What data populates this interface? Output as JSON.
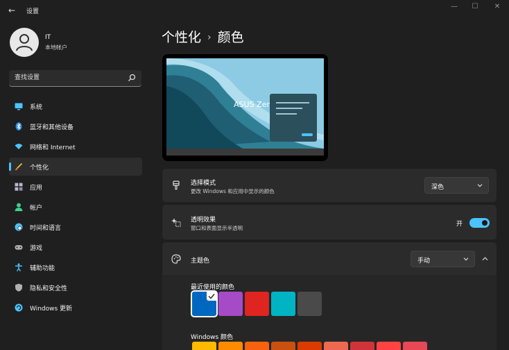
{
  "window": {
    "title": "设置",
    "controls": {
      "minimize": "—",
      "maximize": "☐",
      "close": "✕"
    }
  },
  "user": {
    "name": "IT",
    "account_type": "本地帐户"
  },
  "search": {
    "placeholder": "查找设置",
    "value": ""
  },
  "sidebar": {
    "items": [
      {
        "label": "系统",
        "icon": "monitor-icon",
        "color": "#4cc2ff"
      },
      {
        "label": "蓝牙和其他设备",
        "icon": "bluetooth-icon",
        "color": "#4cc2ff"
      },
      {
        "label": "网络和 Internet",
        "icon": "wifi-icon",
        "color": "#4cc2ff"
      },
      {
        "label": "个性化",
        "icon": "brush-icon",
        "color": "#f0a030",
        "active": true
      },
      {
        "label": "应用",
        "icon": "apps-icon",
        "color": "#b0b0c8"
      },
      {
        "label": "帐户",
        "icon": "person-icon",
        "color": "#3ecf8e"
      },
      {
        "label": "时间和语言",
        "icon": "globe-clock-icon",
        "color": "#4cc2ff"
      },
      {
        "label": "游戏",
        "icon": "gamepad-icon",
        "color": "#b0b0b0"
      },
      {
        "label": "辅助功能",
        "icon": "accessibility-icon",
        "color": "#4cc2ff"
      },
      {
        "label": "隐私和安全性",
        "icon": "shield-icon",
        "color": "#b0b0b0"
      },
      {
        "label": "Windows 更新",
        "icon": "update-icon",
        "color": "#4cc2ff"
      }
    ]
  },
  "breadcrumb": {
    "parent": "个性化",
    "separator": "›",
    "current": "颜色"
  },
  "preview": {
    "text": "ASUS Zen"
  },
  "mode": {
    "title": "选择模式",
    "subtitle": "更改 Windows 和应用中显示的颜色",
    "value": "深色"
  },
  "transparency": {
    "title": "透明效果",
    "subtitle": "窗口和表面显示半透明",
    "state_label": "开",
    "on": true
  },
  "accent": {
    "title": "主题色",
    "value": "手动",
    "recent_label": "最近使用的颜色",
    "recent_colors": [
      "#0067c0",
      "#a74ac7",
      "#e0241f",
      "#00b4c4",
      "#4a4a4a"
    ],
    "selected_index": 0,
    "windows_label": "Windows 颜色",
    "windows_colors": [
      "#ffb900",
      "#ff8c00",
      "#f7630c",
      "#ca5010",
      "#da3b01",
      "#ef6950",
      "#d13438",
      "#ff4343",
      "#e74856"
    ]
  }
}
